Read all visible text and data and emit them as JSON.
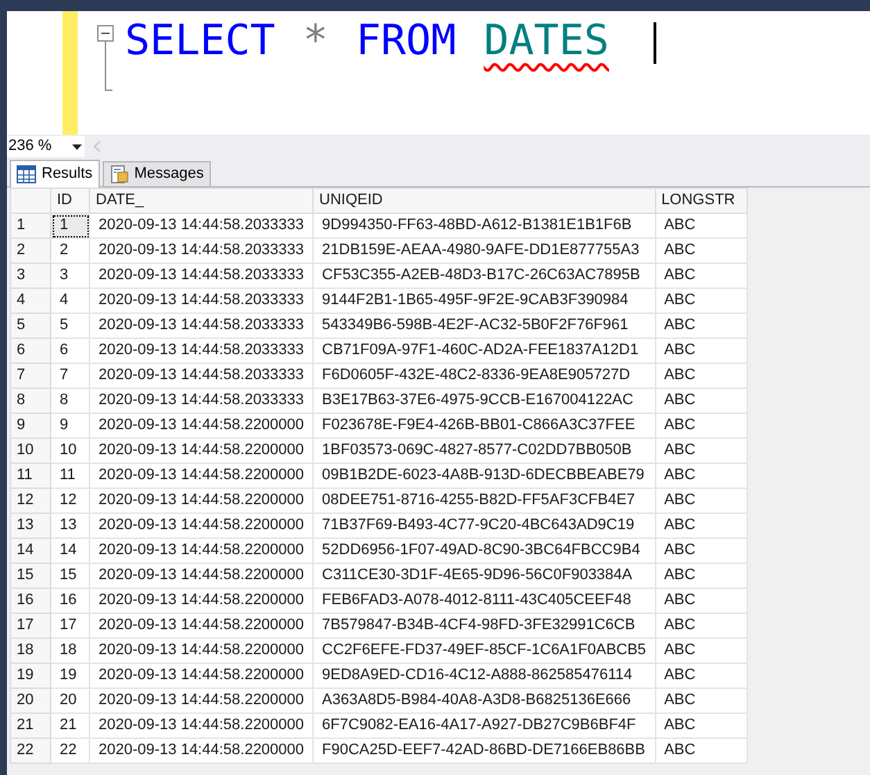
{
  "editor": {
    "tokens": [
      {
        "text": "SELECT",
        "kind": "keyword",
        "error": false
      },
      {
        "text": "*",
        "kind": "operator",
        "error": false
      },
      {
        "text": "FROM",
        "kind": "keyword",
        "error": false
      },
      {
        "text": "DATES",
        "kind": "identifier",
        "error": true
      }
    ],
    "collapse_expanded": true
  },
  "zoom": {
    "value": "236 %"
  },
  "tabs": [
    {
      "label": "Results",
      "selected": true,
      "kind": "grid"
    },
    {
      "label": "Messages",
      "selected": false,
      "kind": "messages"
    }
  ],
  "table": {
    "columns": [
      "ID",
      "DATE_",
      "UNIQEID",
      "LONGSTR"
    ],
    "rows": [
      {
        "row": "1",
        "cells": [
          "1",
          "2020-09-13 14:44:58.2033333",
          "9D994350-FF63-48BD-A612-B1381E1B1F6B",
          "ABC"
        ],
        "focused": true
      },
      {
        "row": "2",
        "cells": [
          "2",
          "2020-09-13 14:44:58.2033333",
          "21DB159E-AEAA-4980-9AFE-DD1E877755A3",
          "ABC"
        ],
        "focused": false
      },
      {
        "row": "3",
        "cells": [
          "3",
          "2020-09-13 14:44:58.2033333",
          "CF53C355-A2EB-48D3-B17C-26C63AC7895B",
          "ABC"
        ],
        "focused": false
      },
      {
        "row": "4",
        "cells": [
          "4",
          "2020-09-13 14:44:58.2033333",
          "9144F2B1-1B65-495F-9F2E-9CAB3F390984",
          "ABC"
        ],
        "focused": false
      },
      {
        "row": "5",
        "cells": [
          "5",
          "2020-09-13 14:44:58.2033333",
          "543349B6-598B-4E2F-AC32-5B0F2F76F961",
          "ABC"
        ],
        "focused": false
      },
      {
        "row": "6",
        "cells": [
          "6",
          "2020-09-13 14:44:58.2033333",
          "CB71F09A-97F1-460C-AD2A-FEE1837A12D1",
          "ABC"
        ],
        "focused": false
      },
      {
        "row": "7",
        "cells": [
          "7",
          "2020-09-13 14:44:58.2033333",
          "F6D0605F-432E-48C2-8336-9EA8E905727D",
          "ABC"
        ],
        "focused": false
      },
      {
        "row": "8",
        "cells": [
          "8",
          "2020-09-13 14:44:58.2033333",
          "B3E17B63-37E6-4975-9CCB-E167004122AC",
          "ABC"
        ],
        "focused": false
      },
      {
        "row": "9",
        "cells": [
          "9",
          "2020-09-13 14:44:58.2200000",
          "F023678E-F9E4-426B-BB01-C866A3C37FEE",
          "ABC"
        ],
        "focused": false
      },
      {
        "row": "10",
        "cells": [
          "10",
          "2020-09-13 14:44:58.2200000",
          "1BF03573-069C-4827-8577-C02DD7BB050B",
          "ABC"
        ],
        "focused": false
      },
      {
        "row": "11",
        "cells": [
          "11",
          "2020-09-13 14:44:58.2200000",
          "09B1B2DE-6023-4A8B-913D-6DECBBEABE79",
          "ABC"
        ],
        "focused": false
      },
      {
        "row": "12",
        "cells": [
          "12",
          "2020-09-13 14:44:58.2200000",
          "08DEE751-8716-4255-B82D-FF5AF3CFB4E7",
          "ABC"
        ],
        "focused": false
      },
      {
        "row": "13",
        "cells": [
          "13",
          "2020-09-13 14:44:58.2200000",
          "71B37F69-B493-4C77-9C20-4BC643AD9C19",
          "ABC"
        ],
        "focused": false
      },
      {
        "row": "14",
        "cells": [
          "14",
          "2020-09-13 14:44:58.2200000",
          "52DD6956-1F07-49AD-8C90-3BC64FBCC9B4",
          "ABC"
        ],
        "focused": false
      },
      {
        "row": "15",
        "cells": [
          "15",
          "2020-09-13 14:44:58.2200000",
          "C311CE30-3D1F-4E65-9D96-56C0F903384A",
          "ABC"
        ],
        "focused": false
      },
      {
        "row": "16",
        "cells": [
          "16",
          "2020-09-13 14:44:58.2200000",
          "FEB6FAD3-A078-4012-8111-43C405CEEF48",
          "ABC"
        ],
        "focused": false
      },
      {
        "row": "17",
        "cells": [
          "17",
          "2020-09-13 14:44:58.2200000",
          "7B579847-B34B-4CF4-98FD-3FE32991C6CB",
          "ABC"
        ],
        "focused": false
      },
      {
        "row": "18",
        "cells": [
          "18",
          "2020-09-13 14:44:58.2200000",
          "CC2F6EFE-FD37-49EF-85CF-1C6A1F0ABCB5",
          "ABC"
        ],
        "focused": false
      },
      {
        "row": "19",
        "cells": [
          "19",
          "2020-09-13 14:44:58.2200000",
          "9ED8A9ED-CD16-4C12-A888-862585476114",
          "ABC"
        ],
        "focused": false
      },
      {
        "row": "20",
        "cells": [
          "20",
          "2020-09-13 14:44:58.2200000",
          "A363A8D5-B984-40A8-A3D8-B6825136E666",
          "ABC"
        ],
        "focused": false
      },
      {
        "row": "21",
        "cells": [
          "21",
          "2020-09-13 14:44:58.2200000",
          "6F7C9082-EA16-4A17-A927-DB27C9B6BF4F",
          "ABC"
        ],
        "focused": false
      },
      {
        "row": "22",
        "cells": [
          "22",
          "2020-09-13 14:44:58.2200000",
          "F90CA25D-EEF7-42AD-86BD-DE7166EB86BB",
          "ABC"
        ],
        "focused": false
      }
    ]
  }
}
